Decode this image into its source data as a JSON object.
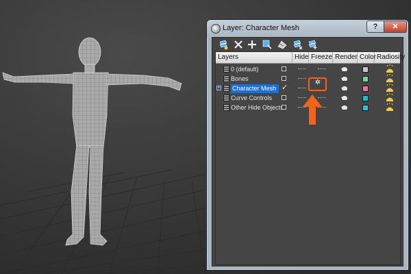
{
  "window": {
    "title": "Layer: Character Mesh",
    "help_label": "?",
    "close_label": "✕"
  },
  "toolbar": {
    "tools": [
      {
        "name": "create-layer-icon"
      },
      {
        "name": "delete-layer-icon"
      },
      {
        "name": "add-to-layer-icon"
      },
      {
        "name": "select-objects-icon"
      },
      {
        "name": "highlight-selected-icon"
      },
      {
        "name": "hide-all-layers-icon"
      },
      {
        "name": "freeze-all-layers-icon"
      }
    ]
  },
  "table": {
    "headers": [
      "Layers",
      "Hide",
      "Freeze",
      "Render",
      "Color",
      "Radiosity"
    ],
    "rows": [
      {
        "name": "0 (default)",
        "selected": false,
        "active": false,
        "color": "#c9c9c9"
      },
      {
        "name": "Bones",
        "selected": false,
        "active": false,
        "color": "#7bd39a"
      },
      {
        "name": "Character Mesh",
        "selected": true,
        "active": true,
        "color": "#e07aa0"
      },
      {
        "name": "Curve Controls",
        "selected": false,
        "active": false,
        "color": "#2ab6c6"
      },
      {
        "name": "Other Hide Objects",
        "selected": false,
        "active": false,
        "color": "#36c0d8"
      }
    ],
    "frozen_icon": "✲"
  },
  "colors": {
    "accent": "#f0641e",
    "selection": "#1d6fd1",
    "background": "#3b3b3b"
  }
}
